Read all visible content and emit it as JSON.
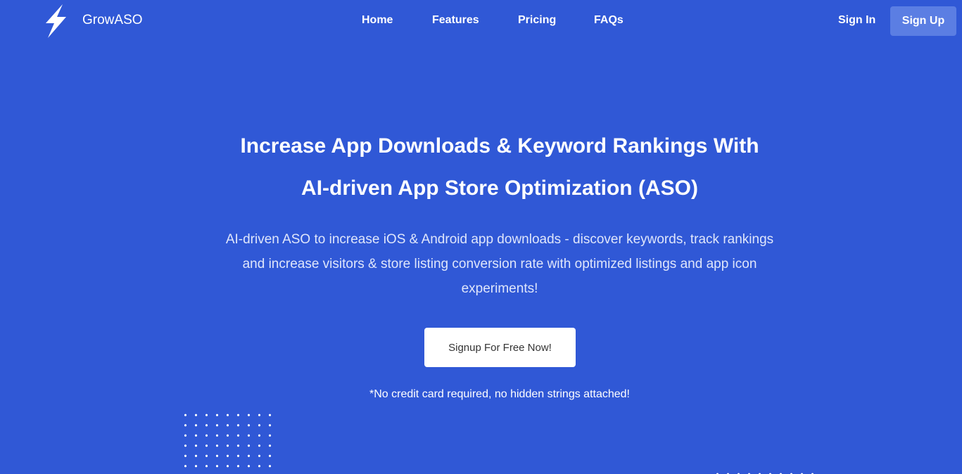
{
  "brand": {
    "name": "GrowASO",
    "icon": "lightning-bolt-icon"
  },
  "nav": {
    "items": [
      {
        "label": "Home"
      },
      {
        "label": "Features"
      },
      {
        "label": "Pricing"
      },
      {
        "label": "FAQs"
      }
    ]
  },
  "auth": {
    "sign_in": "Sign In",
    "sign_up": "Sign Up"
  },
  "hero": {
    "title_line1": "Increase App Downloads & Keyword Rankings With",
    "title_line2": "AI-driven App Store Optimization (ASO)",
    "subtitle": "AI-driven ASO to increase iOS & Android app downloads - discover keywords, track rankings and increase visitors & store listing conversion rate with optimized listings and app icon experiments!",
    "cta_label": "Signup For Free Now!",
    "note": "*No credit card required, no hidden strings attached!"
  },
  "colors": {
    "background": "#3058d6",
    "signup_button": "#5b7ee3",
    "cta_background": "#ffffff"
  }
}
